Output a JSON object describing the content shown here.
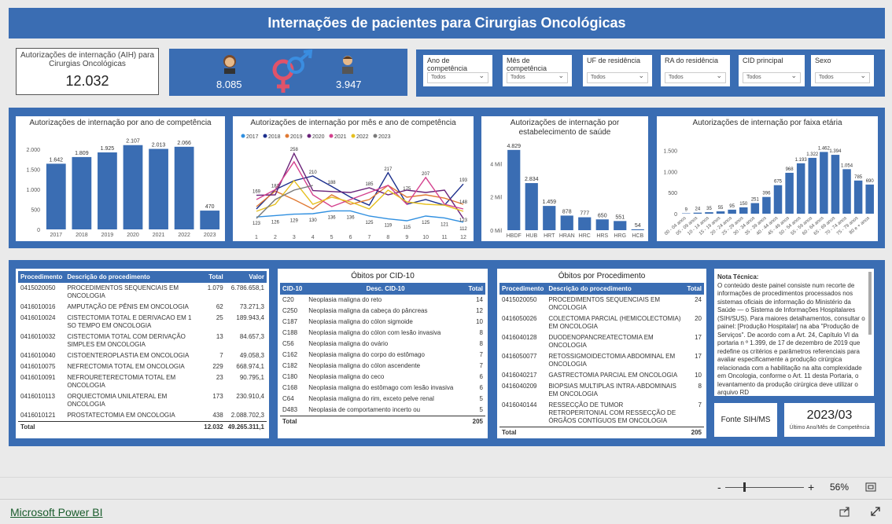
{
  "header": {
    "title": "Internações de pacientes para Cirurgias Oncológicas"
  },
  "kpi": {
    "label": "Autorizações de internação (AIH) para Cirurgias Oncológicas",
    "value": "12.032"
  },
  "gender": {
    "male": "8.085",
    "female": "3.947"
  },
  "filters": [
    {
      "label": "Ano de competência",
      "value": "Todos"
    },
    {
      "label": "Mês de competência",
      "value": "Todos"
    },
    {
      "label": "UF de residência",
      "value": "Todos"
    },
    {
      "label": "RA do residência",
      "value": "Todos"
    },
    {
      "label": "CID principal",
      "value": "Todos"
    },
    {
      "label": "Sexo",
      "value": "Todos"
    }
  ],
  "chart_data": [
    {
      "type": "bar",
      "title": "Autorizações de internação por ano de competência",
      "categories": [
        "2017",
        "2018",
        "2019",
        "2020",
        "2021",
        "2022",
        "2023"
      ],
      "values": [
        1642,
        1809,
        1925,
        2107,
        2013,
        2066,
        470
      ],
      "labels": [
        "1.642",
        "1.809",
        "1.925",
        "2.107",
        "2.013",
        "2.066",
        "470"
      ],
      "yticks": [
        "0",
        "500",
        "1.000",
        "1.500",
        "2.000"
      ],
      "ylim": [
        0,
        2200
      ]
    },
    {
      "type": "line",
      "title": "Autorizações de internação por mês e ano de competência",
      "x": [
        "1",
        "2",
        "3",
        "4",
        "5",
        "6",
        "7",
        "8",
        "9",
        "10",
        "11",
        "12"
      ],
      "series": [
        {
          "name": "2017",
          "color": "#2f8fe0",
          "values": [
            123,
            126,
            129,
            130,
            136,
            136,
            125,
            119,
            115,
            125,
            121,
            112
          ]
        },
        {
          "name": "2018",
          "color": "#1c2f8c",
          "values": [
            140,
            181,
            200,
            210,
            188,
            165,
            148,
            217,
            150,
            160,
            148,
            193
          ]
        },
        {
          "name": "2019",
          "color": "#e07a34",
          "values": [
            145,
            178,
            160,
            140,
            170,
            150,
            160,
            190,
            165,
            170,
            163,
            150
          ]
        },
        {
          "name": "2020",
          "color": "#6a2379",
          "values": [
            169,
            170,
            258,
            179,
            177,
            175,
            185,
            170,
            180,
            175,
            180,
            120
          ]
        },
        {
          "name": "2021",
          "color": "#d4418e",
          "values": [
            160,
            181,
            240,
            170,
            145,
            160,
            175,
            190,
            150,
            207,
            150,
            140
          ]
        },
        {
          "name": "2022",
          "color": "#e6c020",
          "values": [
            135,
            150,
            200,
            150,
            165,
            155,
            140,
            180,
            155,
            150,
            148,
            135
          ]
        },
        {
          "name": "2023",
          "color": "#7a7a7a",
          "values": [
            120,
            160,
            180,
            190,
            null,
            null,
            null,
            null,
            null,
            null,
            null,
            null
          ]
        }
      ],
      "labels": [
        "123",
        "126",
        "129",
        "130",
        "136",
        "136",
        "125",
        "119",
        "115",
        "125",
        "121",
        "112",
        "169",
        "181",
        "258",
        "210",
        "188",
        "185",
        "217",
        "175",
        "207",
        "193",
        "148",
        "123"
      ],
      "ylim": [
        100,
        270
      ]
    },
    {
      "type": "bar",
      "title": "Autorizações de internação por estabelecimento de saúde",
      "categories": [
        "HBDF",
        "HUB",
        "HRT",
        "HRAN",
        "HRC",
        "HRS",
        "HRG",
        "HCB"
      ],
      "values": [
        4829,
        2834,
        1459,
        878,
        777,
        650,
        551,
        54
      ],
      "labels": [
        "4.829",
        "2.834",
        "1.459",
        "878",
        "777",
        "650",
        "551",
        "54"
      ],
      "yticks": [
        "0 Mil",
        "2 Mil",
        "4 Mil"
      ],
      "ylim": [
        0,
        5200
      ]
    },
    {
      "type": "bar",
      "title": "Autorizações de internação por faixa etária",
      "categories": [
        "00 - 04 anos",
        "05 - 09 anos",
        "10 - 14 anos",
        "15 - 19 anos",
        "20 - 24 anos",
        "25 - 29 anos",
        "30 - 34 anos",
        "35 - 39 anos",
        "40 - 44 anos",
        "45 - 49 anos",
        "50 - 54 anos",
        "55 - 59 anos",
        "60 - 64 anos",
        "65 - 69 anos",
        "70 - 74 anos",
        "75 - 79 anos",
        "80 e + anos"
      ],
      "values": [
        9,
        24,
        35,
        55,
        95,
        150,
        251,
        396,
        675,
        968,
        1193,
        1322,
        1462,
        1394,
        1054,
        785,
        690
      ],
      "labels": [
        "9",
        "24",
        "35",
        "55",
        "95",
        "150",
        "251",
        "396",
        "675",
        "968",
        "1.193",
        "1.322",
        "1.462",
        "1.394",
        "1.054",
        "785",
        "690"
      ],
      "yticks": [
        "0",
        "500",
        "1.000",
        "1.500"
      ],
      "ylim": [
        0,
        1600
      ]
    }
  ],
  "proc_table": {
    "headers": [
      "Procedimento",
      "Descrição do procedimento",
      "Total",
      "Valor"
    ],
    "rows": [
      [
        "0415020050",
        "PROCEDIMENTOS SEQUENCIAIS EM ONCOLOGIA",
        "1.079",
        "6.786.658,1"
      ],
      [
        "0416010016",
        "AMPUTAÇÃO DE PÊNIS EM ONCOLOGIA",
        "62",
        "73.271,3"
      ],
      [
        "0416010024",
        "CISTECTOMIA TOTAL E DERIVACAO EM 1 SO TEMPO EM ONCOLOGIA",
        "25",
        "189.943,4"
      ],
      [
        "0416010032",
        "CISTECTOMIA TOTAL COM DERIVAÇÃO SIMPLES EM ONCOLOGIA",
        "13",
        "84.657,3"
      ],
      [
        "0416010040",
        "CISTOENTEROPLASTIA EM ONCOLOGIA",
        "7",
        "49.058,3"
      ],
      [
        "0416010075",
        "NEFRECTOMIA TOTAL EM ONCOLOGIA",
        "229",
        "668.974,1"
      ],
      [
        "0416010091",
        "NEFROURETERECTOMIA TOTAL EM ONCOLOGIA",
        "23",
        "90.795,1"
      ],
      [
        "0416010113",
        "ORQUIECTOMIA UNILATERAL EM ONCOLOGIA",
        "173",
        "230.910,4"
      ],
      [
        "0416010121",
        "PROSTATECTOMIA EM ONCOLOGIA",
        "438",
        "2.088.702,3"
      ]
    ],
    "total": [
      "Total",
      "",
      "12.032",
      "49.265.311,1"
    ]
  },
  "cid_table": {
    "title": "Óbitos por CID-10",
    "headers": [
      "CID-10",
      "Desc. CID-10",
      "Total"
    ],
    "rows": [
      [
        "C20",
        "Neoplasia maligna do reto",
        "14"
      ],
      [
        "C250",
        "Neoplasia maligna da cabeça do pâncreas",
        "12"
      ],
      [
        "C187",
        "Neoplasia maligna do cólon sigmoide",
        "10"
      ],
      [
        "C188",
        "Neoplasia maligna do cólon com lesão invasiva",
        "8"
      ],
      [
        "C56",
        "Neoplasia maligna do ovário",
        "8"
      ],
      [
        "C162",
        "Neoplasia maligna do corpo do estômago",
        "7"
      ],
      [
        "C182",
        "Neoplasia maligna do cólon ascendente",
        "7"
      ],
      [
        "C180",
        "Neoplasia maligna do ceco",
        "6"
      ],
      [
        "C168",
        "Neoplasia maligna do estômago com lesão invasiva",
        "6"
      ],
      [
        "C64",
        "Neoplasia maligna do rim, exceto pelve renal",
        "5"
      ],
      [
        "D483",
        "Neoplasia de comportamento incerto ou",
        "5"
      ]
    ],
    "total": [
      "Total",
      "",
      "205"
    ]
  },
  "obitos_proc": {
    "title": "Óbitos por Procedimento",
    "headers": [
      "Procedimento",
      "Descrição do procedimento",
      "Total"
    ],
    "rows": [
      [
        "0415020050",
        "PROCEDIMENTOS SEQUENCIAIS EM ONCOLOGIA",
        "24"
      ],
      [
        "0416050026",
        "COLECTOMIA PARCIAL (HEMICOLECTOMIA) EM ONCOLOGIA",
        "20"
      ],
      [
        "0416040128",
        "DUODENOPANCREATECTOMIA EM ONCOLOGIA",
        "17"
      ],
      [
        "0416050077",
        "RETOSSIGMOIDECTOMIA ABDOMINAL EM ONCOLOGIA",
        "17"
      ],
      [
        "0416040217",
        "GASTRECTOMIA PARCIAL EM ONCOLOGIA",
        "10"
      ],
      [
        "0416040209",
        "BIOPSIAS MULTIPLAS INTRA-ABDOMINAIS EM ONCOLOGIA",
        "8"
      ],
      [
        "0416040144",
        "RESSECÇÃO DE TUMOR RETROPERITONIAL COM RESSECÇÃO DE ÓRGÃOS CONTÍGUOS EM ONCOLOGIA",
        "7"
      ]
    ],
    "total": [
      "Total",
      "",
      "205"
    ]
  },
  "note": {
    "title": "Nota Técnica:",
    "body": "O conteúdo deste painel consiste num recorte de informações de procedimentos processados nos sistemas oficiais de informação do Ministério da Saúde — o Sistema de Informações Hospitalares (SIH/SUS). Para maiores detalhamentos, consultar o painel: [Produção Hospitalar] na aba \"Produção de Serviços\". De acordo com a Art. 24, Capítulo VI da portaria n º 1.399, de 17 de dezembro de 2019 que redefine os critérios e parâmetros referenciais para avaliar especificamente a produção cirúrgica relacionada com a habilitação na alta complexidade em Oncologia, conforme o Art. 11 desta Portaria, o levantamento da produção cirúrgica deve utilizar o arquivo RD"
  },
  "source": {
    "label": "Fonte SIH/MS"
  },
  "last": {
    "value": "2023/03",
    "label": "Último Ano/Mês de Competência"
  },
  "zoom": {
    "minus": "-",
    "plus": "+",
    "level": "56%"
  },
  "footer": {
    "brand": "Microsoft Power BI"
  }
}
